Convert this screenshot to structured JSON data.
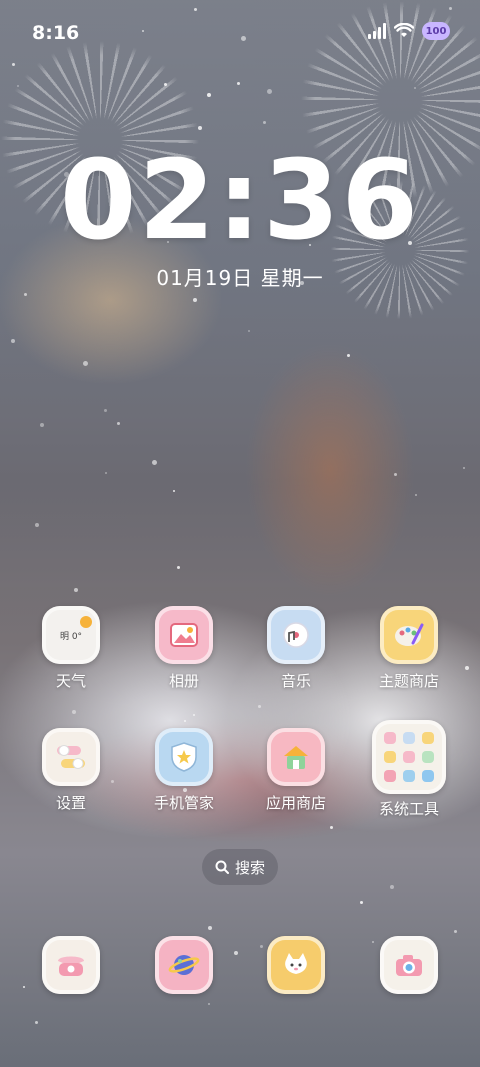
{
  "status_bar": {
    "time": "8:16",
    "battery": "100"
  },
  "lock_clock": {
    "time": "02:36",
    "date": "01月19日  星期一"
  },
  "weather_icon_text": "明 0°",
  "apps": [
    {
      "label": "天气",
      "icon": "weather-icon",
      "color": "#f3f1ee"
    },
    {
      "label": "相册",
      "icon": "gallery-icon",
      "color": "#f6b9c9"
    },
    {
      "label": "音乐",
      "icon": "music-icon",
      "color": "#c7dcf2"
    },
    {
      "label": "主题商店",
      "icon": "theme-store-icon",
      "color": "#f8d57a"
    },
    {
      "label": "设置",
      "icon": "settings-icon",
      "color": "#f5efe8"
    },
    {
      "label": "手机管家",
      "icon": "phone-manager-icon",
      "color": "#b9d8f1"
    },
    {
      "label": "应用商店",
      "icon": "app-store-icon",
      "color": "#f7b8c2"
    },
    {
      "label": "系统工具",
      "icon": "system-tools-icon",
      "color": "#f5f1ea"
    }
  ],
  "search": {
    "label": "搜索"
  },
  "dock": [
    {
      "icon": "phone-icon",
      "color": "#f5efe8"
    },
    {
      "icon": "browser-icon",
      "color": "#f5b3c3"
    },
    {
      "icon": "messages-icon",
      "color": "#f6cc6c"
    },
    {
      "icon": "camera-icon",
      "color": "#f5f1ea"
    }
  ]
}
